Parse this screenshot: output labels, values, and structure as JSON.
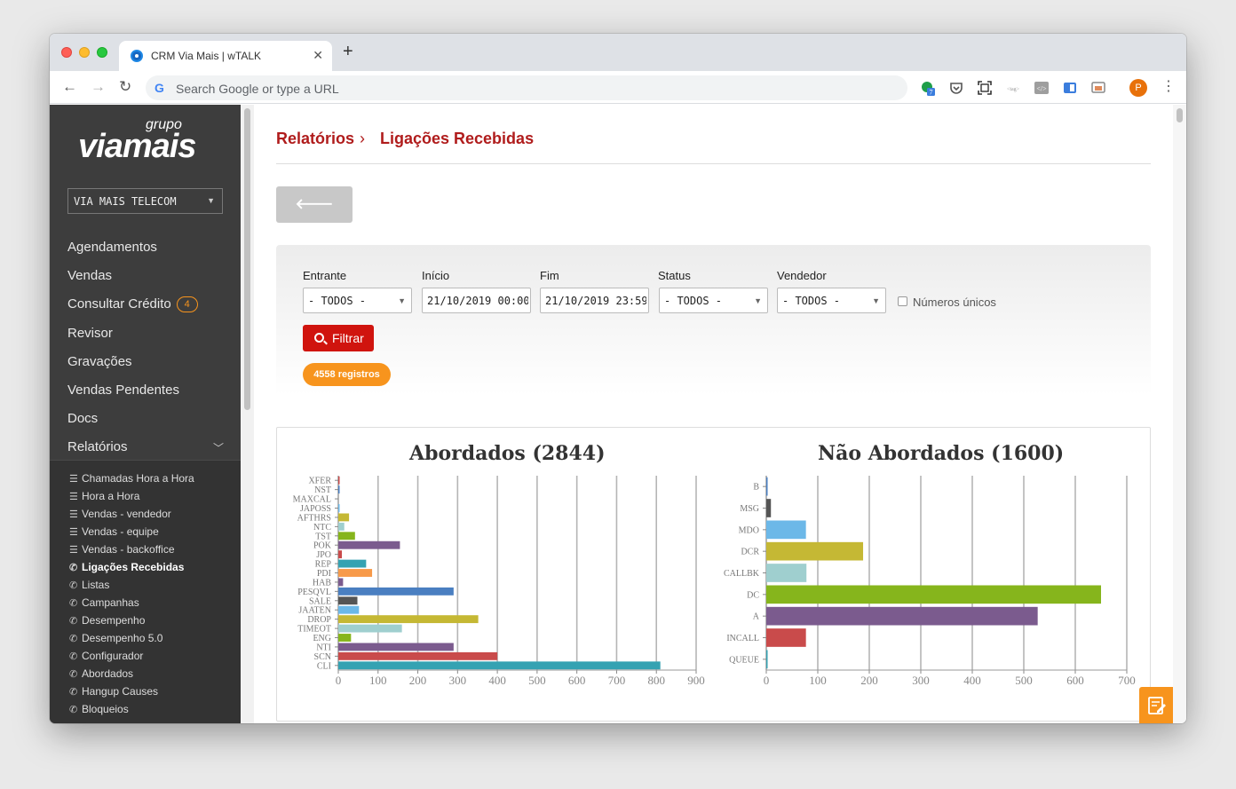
{
  "browser": {
    "tab_title": "CRM Via Mais | wTALK",
    "omnibox_placeholder": "Search Google or type a URL",
    "profile_initial": "P",
    "ext_badge": "7"
  },
  "sidebar": {
    "logo_small": "grupo",
    "logo_main": "viamais",
    "company": "VIA MAIS TELECOM",
    "menu": [
      {
        "label": "Agendamentos"
      },
      {
        "label": "Vendas"
      },
      {
        "label": "Consultar Crédito",
        "badge": "4"
      },
      {
        "label": "Revisor"
      },
      {
        "label": "Gravações"
      },
      {
        "label": "Vendas Pendentes"
      },
      {
        "label": "Docs"
      },
      {
        "label": "Relatórios"
      }
    ],
    "submenu": [
      {
        "label": "Chamadas Hora a Hora",
        "icon": "list-icon"
      },
      {
        "label": "Hora a Hora",
        "icon": "list-icon"
      },
      {
        "label": "Vendas - vendedor",
        "icon": "list-icon"
      },
      {
        "label": "Vendas - equipe",
        "icon": "list-icon"
      },
      {
        "label": "Vendas - backoffice",
        "icon": "list-icon"
      },
      {
        "label": "Ligações Recebidas",
        "icon": "phone-icon",
        "active": true
      },
      {
        "label": "Listas",
        "icon": "phone-icon"
      },
      {
        "label": "Campanhas",
        "icon": "phone-icon"
      },
      {
        "label": "Desempenho",
        "icon": "phone-icon"
      },
      {
        "label": "Desempenho 5.0",
        "icon": "phone-icon"
      },
      {
        "label": "Configurador",
        "icon": "phone-icon"
      },
      {
        "label": "Abordados",
        "icon": "phone-icon"
      },
      {
        "label": "Hangup Causes",
        "icon": "phone-icon"
      },
      {
        "label": "Bloqueios",
        "icon": "phone-icon"
      }
    ]
  },
  "page": {
    "breadcrumb_root": "Relatórios",
    "breadcrumb_sep": "›",
    "breadcrumb_current": "Ligações Recebidas",
    "back_button": "Voltar",
    "filters": {
      "entrante_label": "Entrante",
      "entrante_value": "- TODOS -",
      "inicio_label": "Início",
      "inicio_value": "21/10/2019 00:00",
      "fim_label": "Fim",
      "fim_value": "21/10/2019 23:59",
      "status_label": "Status",
      "status_value": "- TODOS -",
      "vendedor_label": "Vendedor",
      "vendedor_value": "- TODOS -",
      "unique_label": "Números únicos",
      "filter_button": "Filtrar"
    },
    "records_badge": "4558 registros"
  },
  "colors": {
    "brand_red": "#b01c1c",
    "button_red": "#d0140e",
    "accent_orange": "#f7941d",
    "sidebar_bg": "#3d3d3d"
  },
  "chart_data": [
    {
      "type": "bar",
      "orientation": "horizontal",
      "title": "Abordados (2844)",
      "categories": [
        "XFER",
        "NST",
        "MAXCAL",
        "JAPOSS",
        "AFTHRS",
        "NTC",
        "TST",
        "POK",
        "JPO",
        "REP",
        "PDI",
        "HAB",
        "PESQVL",
        "SALE",
        "JAATEN",
        "DROP",
        "TIMEOT",
        "ENG",
        "NTI",
        "SCN",
        "CLI"
      ],
      "values": [
        1,
        1,
        0,
        1,
        27,
        15,
        42,
        155,
        9,
        70,
        85,
        12,
        290,
        48,
        52,
        352,
        160,
        32,
        290,
        400,
        810
      ],
      "colors": [
        "#c94b4b",
        "#4a7fc1",
        "#555",
        "#6cb8e8",
        "#c5b834",
        "#9fcfcf",
        "#86b51c",
        "#7b5b8e",
        "#c94b4b",
        "#35a2b2",
        "#f79a4a",
        "#7b5b8e",
        "#4a7fc1",
        "#555",
        "#6cb8e8",
        "#c5b834",
        "#9fcfcf",
        "#86b51c",
        "#7b5b8e",
        "#c94b4b",
        "#35a2b2"
      ],
      "xlim": [
        0,
        900
      ],
      "xticks": [
        0,
        100,
        200,
        300,
        400,
        500,
        600,
        700,
        800,
        900
      ],
      "grid": true
    },
    {
      "type": "bar",
      "orientation": "horizontal",
      "title": "Não Abordados (1600)",
      "categories": [
        "B",
        "MSG",
        "MDO",
        "DCR",
        "CALLBK",
        "DC",
        "A",
        "INCALL",
        "QUEUE"
      ],
      "values": [
        1,
        9,
        77,
        188,
        78,
        650,
        527,
        77,
        1
      ],
      "colors": [
        "#4a7fc1",
        "#555",
        "#6cb8e8",
        "#c5b834",
        "#9fcfcf",
        "#86b51c",
        "#7b5b8e",
        "#c94b4b",
        "#35a2b2"
      ],
      "xlim": [
        0,
        700
      ],
      "xticks": [
        0,
        100,
        200,
        300,
        400,
        500,
        600,
        700
      ],
      "grid": true
    }
  ]
}
